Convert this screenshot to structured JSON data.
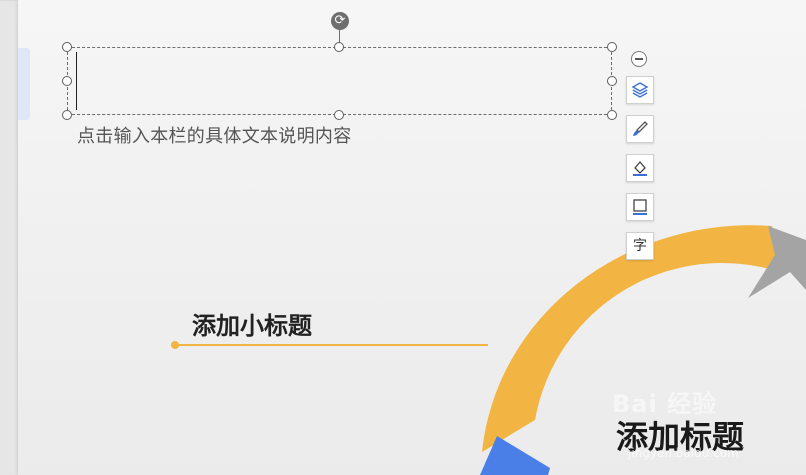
{
  "textbox": {
    "placeholder_text": "点击输入本栏的具体文本说明内容"
  },
  "toolbar": {
    "rotate_icon": "rotate-icon",
    "collapse_icon": "minus-circle-icon",
    "buttons": [
      {
        "icon": "layers-icon"
      },
      {
        "icon": "brush-icon"
      },
      {
        "icon": "fill-bucket-icon"
      },
      {
        "icon": "border-icon"
      },
      {
        "icon": "text-style-icon",
        "glyph": "字"
      }
    ]
  },
  "slide": {
    "subtitle": "添加小标题",
    "title": "添加标题"
  },
  "watermark": {
    "main": "Bai 经验",
    "sub": "jingyan.baidu.com"
  },
  "colors": {
    "accent_orange": "#f2b442",
    "accent_blue": "#4a7fe8",
    "arrow_gray": "#a4a4a4"
  }
}
